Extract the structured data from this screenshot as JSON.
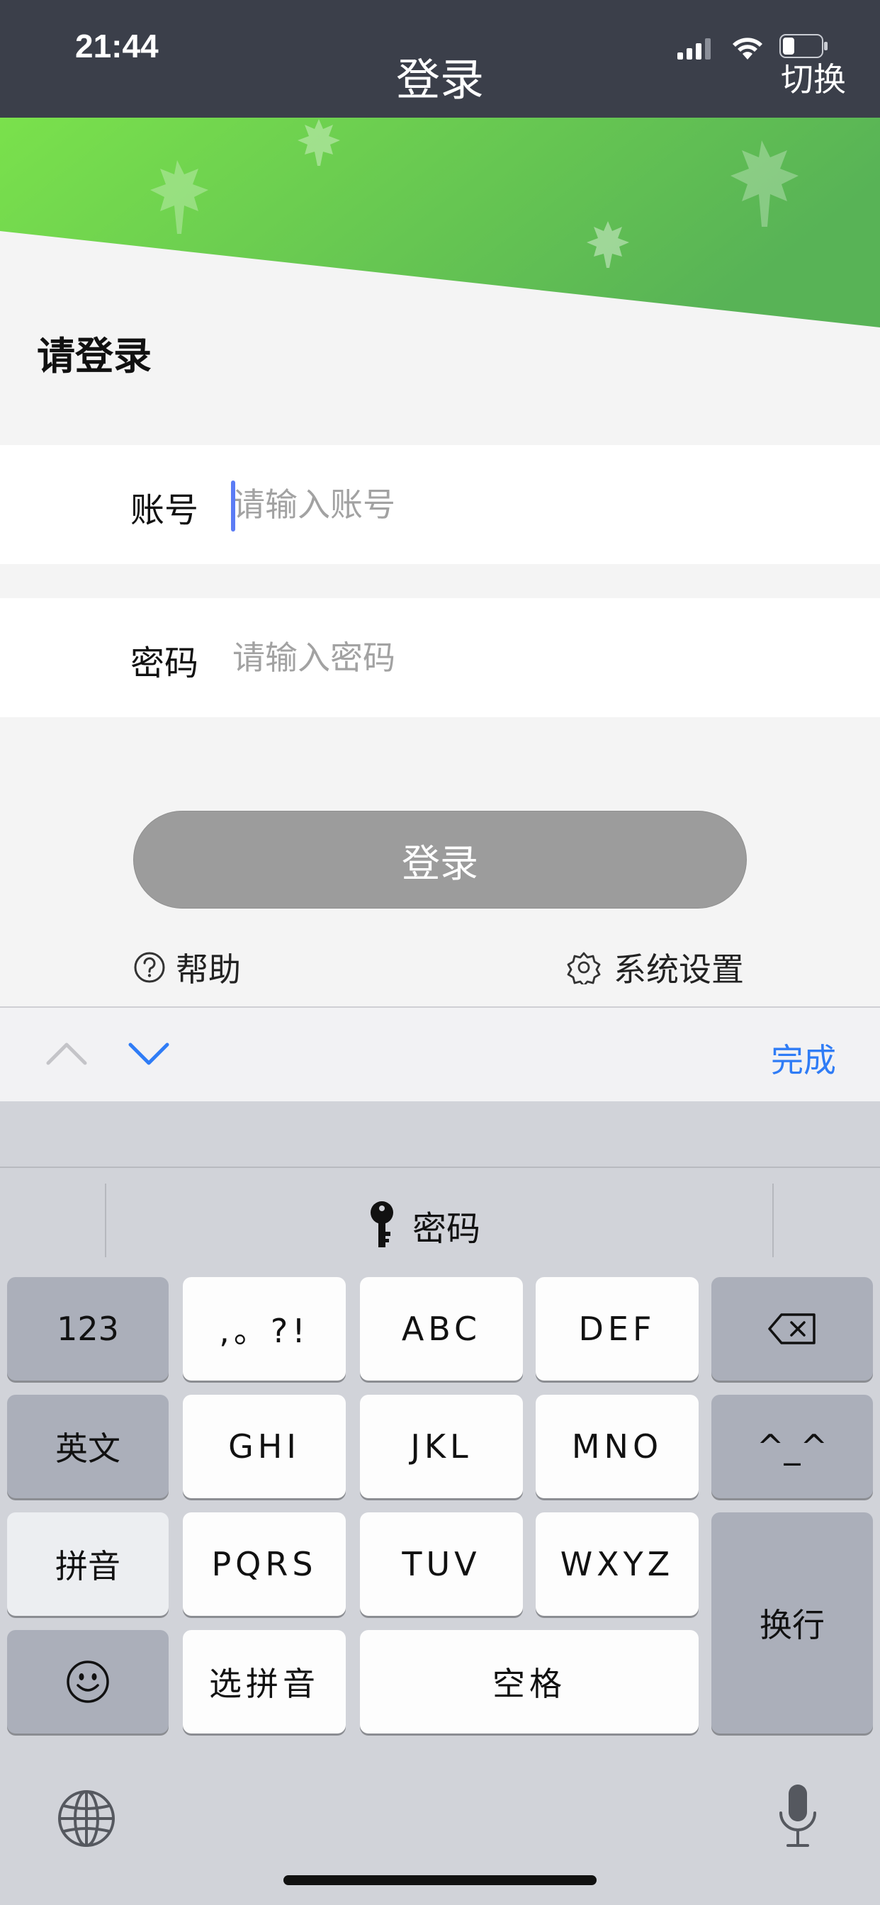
{
  "status_bar": {
    "time": "21:44"
  },
  "header": {
    "title": "登录",
    "switch_label": "切换"
  },
  "login": {
    "heading": "请登录",
    "account": {
      "label": "账号",
      "placeholder": "请输入账号",
      "value": ""
    },
    "password": {
      "label": "密码",
      "placeholder": "请输入密码",
      "value": ""
    },
    "submit_label": "登录",
    "help_label": "帮助",
    "settings_label": "系统设置"
  },
  "accessory_bar": {
    "done_label": "完成"
  },
  "keyboard": {
    "suggestion": "密码",
    "keys": {
      "numbers": "123",
      "punct": ",。?!",
      "abc": "ABC",
      "def": "DEF",
      "english": "英文",
      "ghi": "GHI",
      "jkl": "JKL",
      "mno": "MNO",
      "emoticon": "^_^",
      "pinyin": "拼音",
      "pqrs": "PQRS",
      "tuv": "TUV",
      "wxyz": "WXYZ",
      "newline": "换行",
      "select_pinyin": "选拼音",
      "space": "空格"
    }
  },
  "colors": {
    "header_bg": "#3b3f4a",
    "banner_green": "#6fd14a",
    "button_gray": "#9c9c9c",
    "accent_blue": "#2f7cf6"
  },
  "icons": [
    "signal-icon",
    "wifi-icon",
    "battery-icon",
    "maple-leaf-icon",
    "help-circle-icon",
    "gear-icon",
    "chevron-up-icon",
    "chevron-down-icon",
    "key-icon",
    "backspace-icon",
    "emoji-icon",
    "globe-icon",
    "microphone-icon"
  ]
}
